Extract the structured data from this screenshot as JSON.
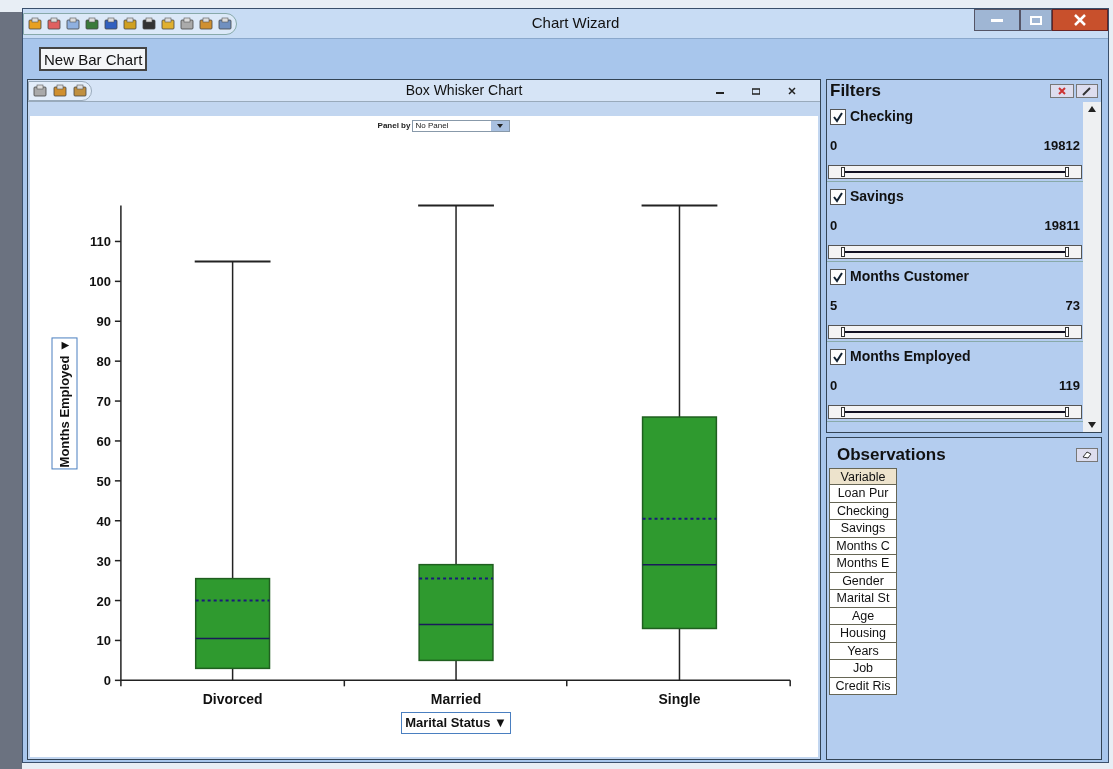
{
  "window": {
    "title": "Chart Wizard"
  },
  "toolbar_button": "New Bar Chart",
  "chart_window": {
    "title": "Box Whisker Chart",
    "panel_by": {
      "label": "Panel by",
      "value": "No Panel"
    },
    "y_axis_button": "Months Employed ▼",
    "x_axis_button": "Marital Status ▼",
    "y_ticks": [
      "110",
      "100",
      "90",
      "80",
      "70",
      "60",
      "50",
      "40",
      "30",
      "20",
      "10",
      "0"
    ],
    "categories": [
      "Divorced",
      "Married",
      "Single"
    ]
  },
  "filters": {
    "title": "Filters",
    "items": [
      {
        "label": "Checking",
        "checked": true,
        "min": "0",
        "max": "19812",
        "level": 1
      },
      {
        "label": "Savings",
        "checked": true,
        "min": "0",
        "max": "19811",
        "level": 1
      },
      {
        "label": "Months Customer",
        "checked": true,
        "min": "5",
        "max": "73",
        "level": 1
      },
      {
        "label": "Months Employed",
        "checked": true,
        "min": "0",
        "max": "119",
        "level": 1
      }
    ]
  },
  "observations": {
    "title": "Observations",
    "header": "Variable",
    "variables": [
      "Loan Pur",
      "Checking",
      "Savings",
      "Months C",
      "Months E",
      "Gender",
      "Marital St",
      "Age",
      "Housing",
      "Years",
      "Job",
      "Credit Ris"
    ]
  }
}
